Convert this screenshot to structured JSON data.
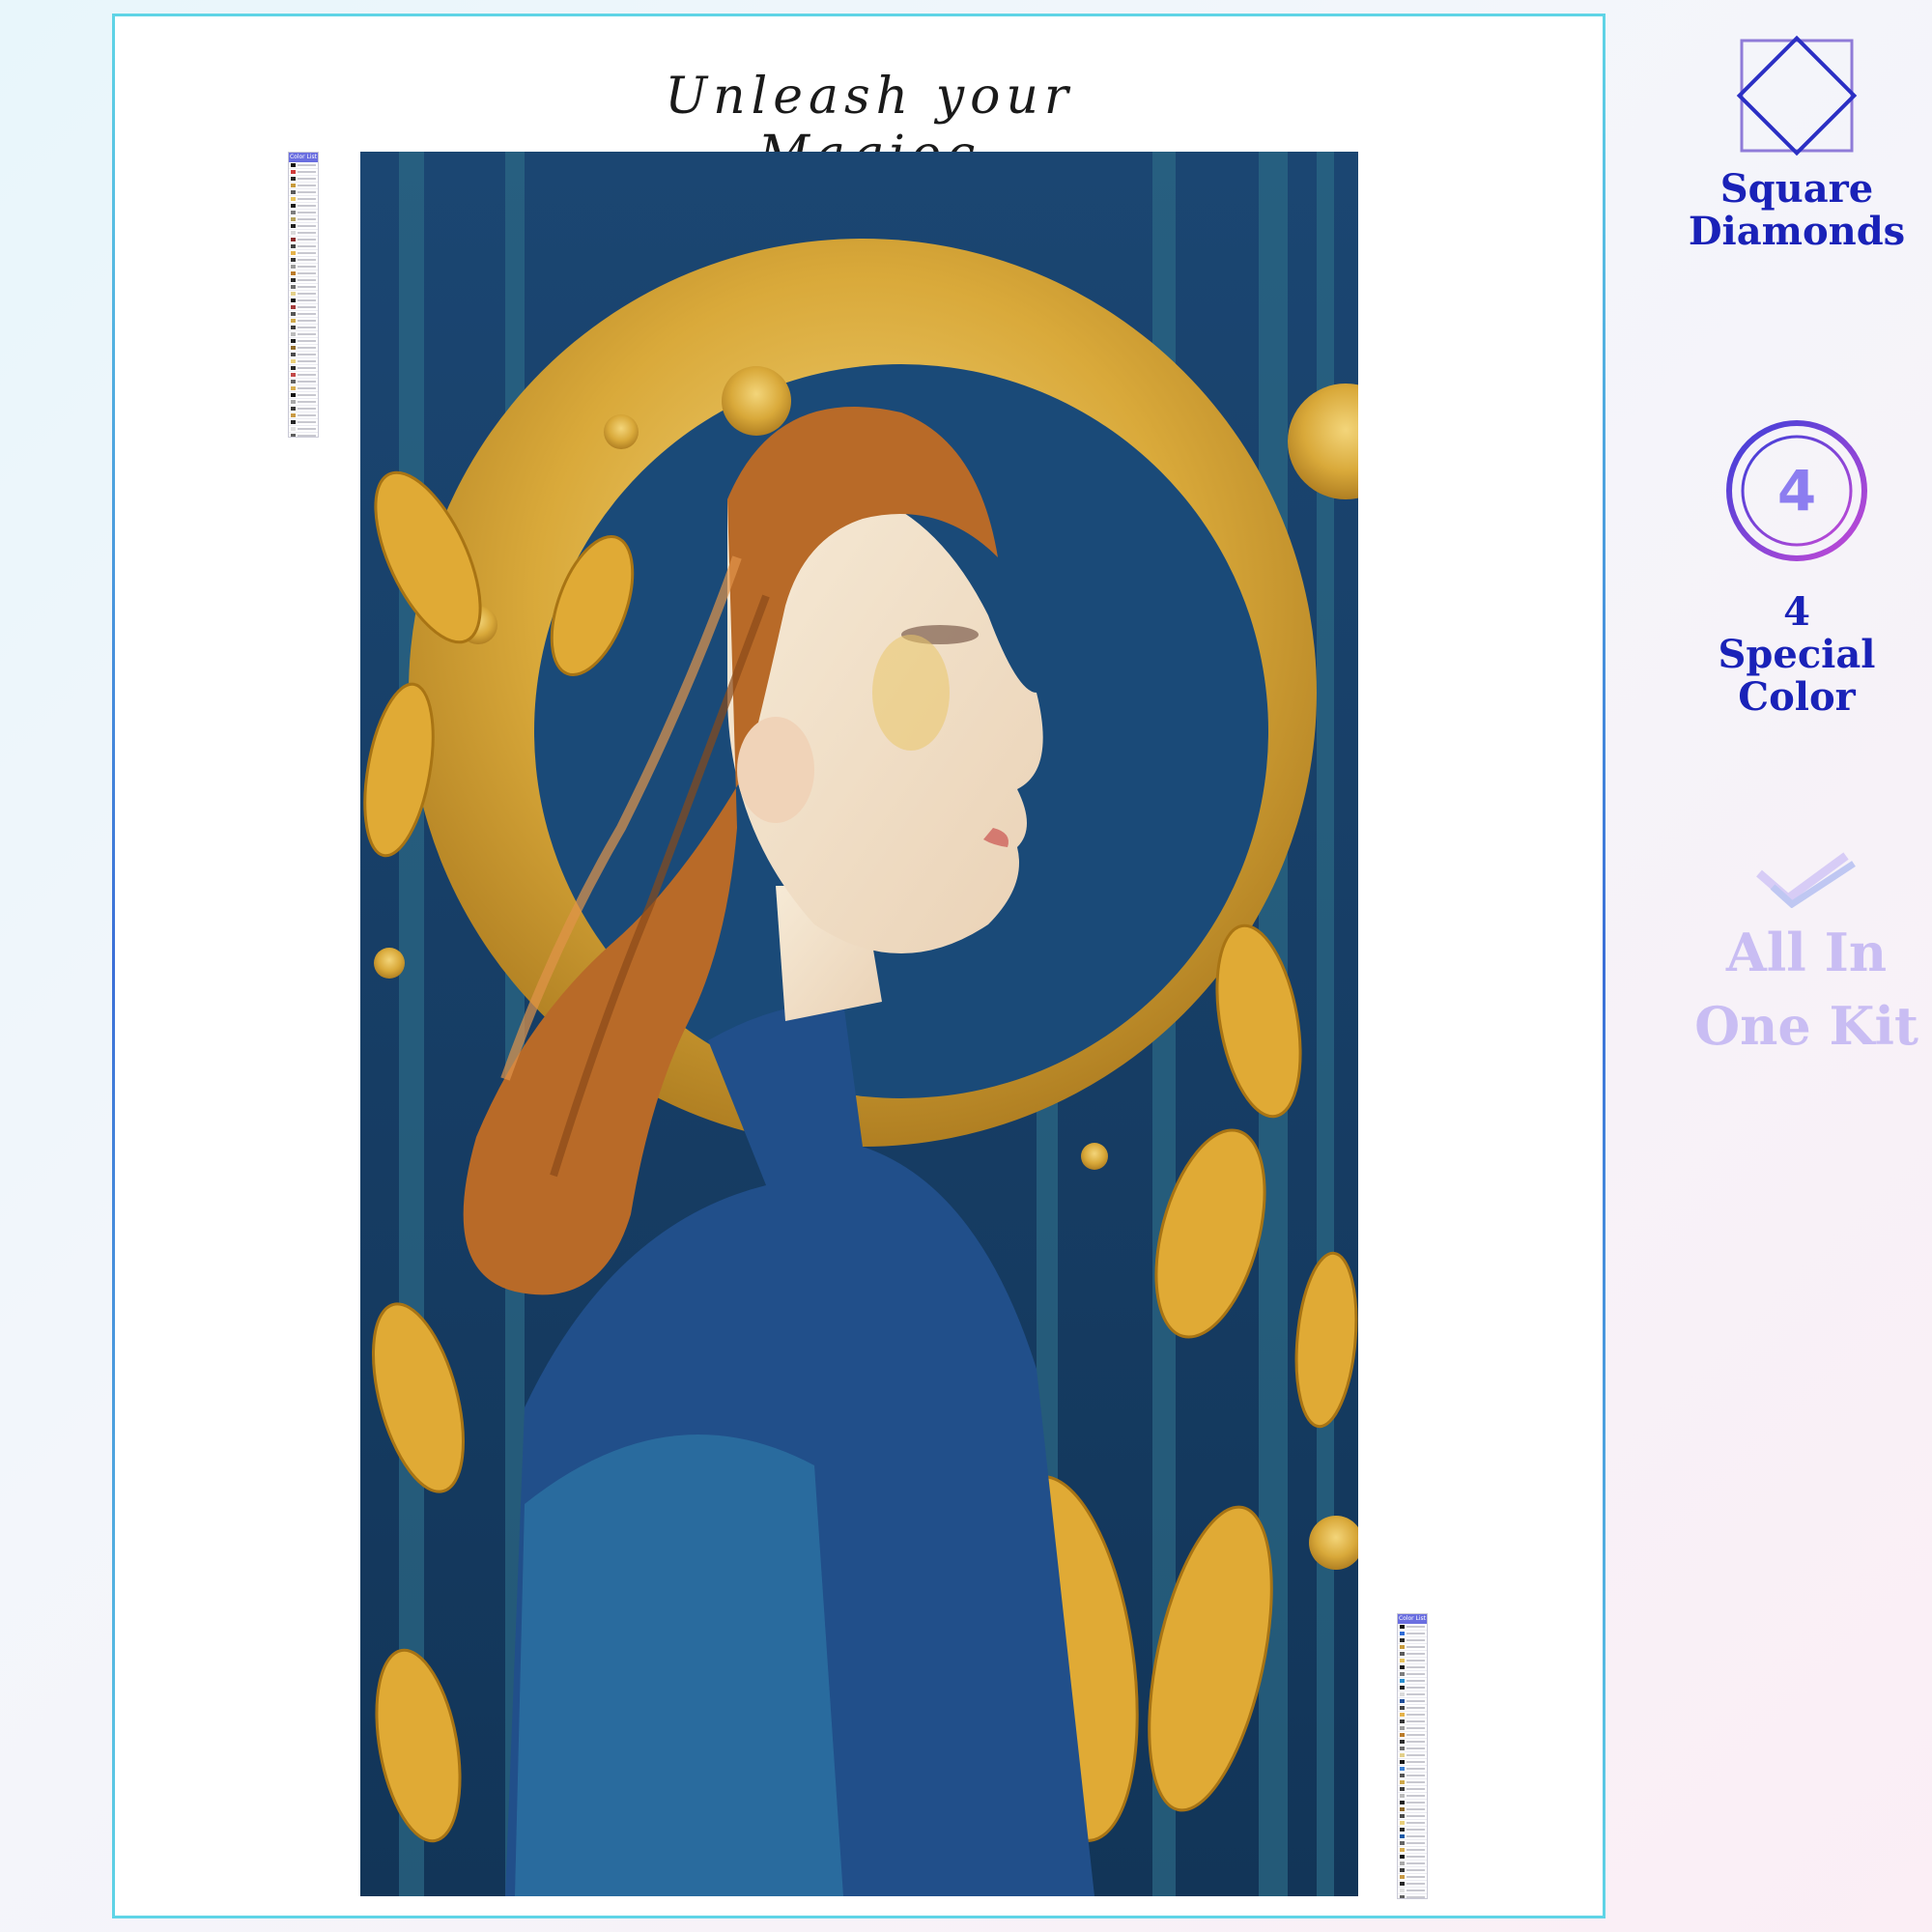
{
  "title": "Unleash your Magioc",
  "legend_left": {
    "header": "Color List",
    "row_colors": [
      "#111111",
      "#d03b3b",
      "#2a2a2a",
      "#c89b3c",
      "#5a5a5a",
      "#e7c25a",
      "#1b1b1b",
      "#7d7d7d",
      "#b5a15a",
      "#222222",
      "#d9d9d9",
      "#8b2a2a",
      "#444444",
      "#e4b24a",
      "#363636",
      "#9a9a9a",
      "#ba7b2b",
      "#2d2d2d",
      "#6c6c6c",
      "#e2d08a",
      "#181818",
      "#a33a3a",
      "#555555",
      "#cfa84a",
      "#3e3e3e",
      "#bbbbbb",
      "#202020",
      "#8f6a2a",
      "#4c4c4c",
      "#e9cf7a",
      "#292929",
      "#c24848",
      "#646464",
      "#d7ad50",
      "#121212",
      "#a8a8a8",
      "#3a3a3a",
      "#c99a44",
      "#262626",
      "#e0e0e0",
      "#5f5f5f"
    ]
  },
  "legend_right": {
    "header": "Color List",
    "row_colors": [
      "#111111",
      "#2e6bd6",
      "#2a2a2a",
      "#c89b3c",
      "#5a5a5a",
      "#e7c25a",
      "#1b1b1b",
      "#7d7d7d",
      "#2a8fd0",
      "#222222",
      "#d9d9d9",
      "#1f4e9a",
      "#444444",
      "#e4b24a",
      "#363636",
      "#9a9a9a",
      "#ba7b2b",
      "#2d2d2d",
      "#6c6c6c",
      "#e2d08a",
      "#181818",
      "#3b7fd4",
      "#555555",
      "#cfa84a",
      "#3e3e3e",
      "#bbbbbb",
      "#202020",
      "#8f6a2a",
      "#4c4c4c",
      "#e9cf7a",
      "#292929",
      "#1a5aa8",
      "#646464",
      "#d7ad50",
      "#121212",
      "#a8a8a8",
      "#3a3a3a",
      "#c99a44",
      "#262626",
      "#e0e0e0",
      "#5f5f5f"
    ]
  },
  "features": {
    "square": {
      "line1": "Square",
      "line2": "Diamonds",
      "icon": "diamond-square-icon"
    },
    "special": {
      "number": "4",
      "line1": "4",
      "line2": "Special",
      "line3": "Color",
      "icon": "circle-number-icon"
    },
    "kit": {
      "line1": "All In",
      "line2": "One Kit",
      "icon": "double-check-icon"
    }
  },
  "colors": {
    "accent_blue": "#1a22b8",
    "kit_lavender": "#c9bdf3",
    "gold": "#d9a93a",
    "deep_blue": "#173d67"
  }
}
